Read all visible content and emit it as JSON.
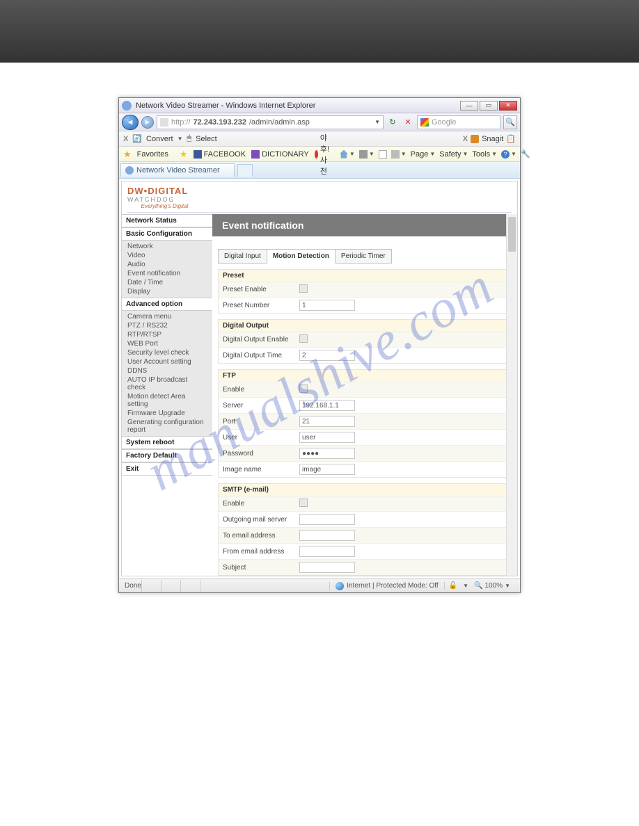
{
  "window": {
    "title": "Network Video Streamer - Windows Internet Explorer",
    "min": "—",
    "max": "▭",
    "close": "✕"
  },
  "nav": {
    "url_prefix": "http://",
    "url_host": "72.243.193.232",
    "url_path": "/admin/admin.asp",
    "search_placeholder": "Google"
  },
  "toolbar1": {
    "convert": "Convert",
    "select": "Select",
    "snagit": "Snagit"
  },
  "favbar": {
    "favorites": "Favorites",
    "facebook": "FACEBOOK",
    "dictionary": "DICTIONARY",
    "yahoo": "야후! 사전",
    "page": "Page",
    "safety": "Safety",
    "tools": "Tools"
  },
  "tabbar": {
    "tab1": "Network Video Streamer"
  },
  "logo": {
    "brand_dw": "DW",
    "brand_digital": "DIGITAL",
    "watchdog": "WATCHDOG",
    "tagline": "Everything's Digital"
  },
  "sidebar": {
    "network_status": "Network Status",
    "basic_config": "Basic Configuration",
    "basic_items": {
      "network": "Network",
      "video": "Video",
      "audio": "Audio",
      "event": "Event notification",
      "datetime": "Date / Time",
      "display": "Display"
    },
    "advanced": "Advanced option",
    "advanced_items": {
      "camera": "Camera menu",
      "ptz": "PTZ / RS232",
      "rtp": "RTP/RTSP",
      "web": "WEB Port",
      "sec": "Security level check",
      "user": "User Account setting",
      "ddns": "DDNS",
      "autoip": "AUTO IP broadcast check",
      "motion": "Motion detect Area setting",
      "fw": "Firmware Upgrade",
      "report": "Generating configuration report"
    },
    "sysreboot": "System reboot",
    "factory": "Factory Default",
    "exit": "Exit"
  },
  "main": {
    "title": "Event notification",
    "tabs": {
      "digital_input": "Digital Input",
      "motion": "Motion Detection",
      "periodic": "Periodic Timer"
    },
    "preset": {
      "title": "Preset",
      "enable": "Preset Enable",
      "number": "Preset Number",
      "number_value": "1"
    },
    "dout": {
      "title": "Digital Output",
      "enable": "Digital Output Enable",
      "time": "Digital Output Time",
      "time_value": "2"
    },
    "ftp": {
      "title": "FTP",
      "enable": "Enable",
      "server": "Server",
      "server_value": "192.168.1.1",
      "port": "Port",
      "port_value": "21",
      "user": "User",
      "user_value": "user",
      "password": "Password",
      "password_value": "●●●●",
      "image": "Image name",
      "image_value": "image"
    },
    "smtp": {
      "title": "SMTP (e-mail)",
      "enable": "Enable",
      "outgoing": "Outgoing mail server",
      "to": "To email address",
      "from": "From email address",
      "subject": "Subject"
    }
  },
  "statusbar": {
    "done": "Done",
    "mode": "Internet | Protected Mode: Off",
    "zoom": "100%"
  },
  "watermark": "manualshive.com"
}
